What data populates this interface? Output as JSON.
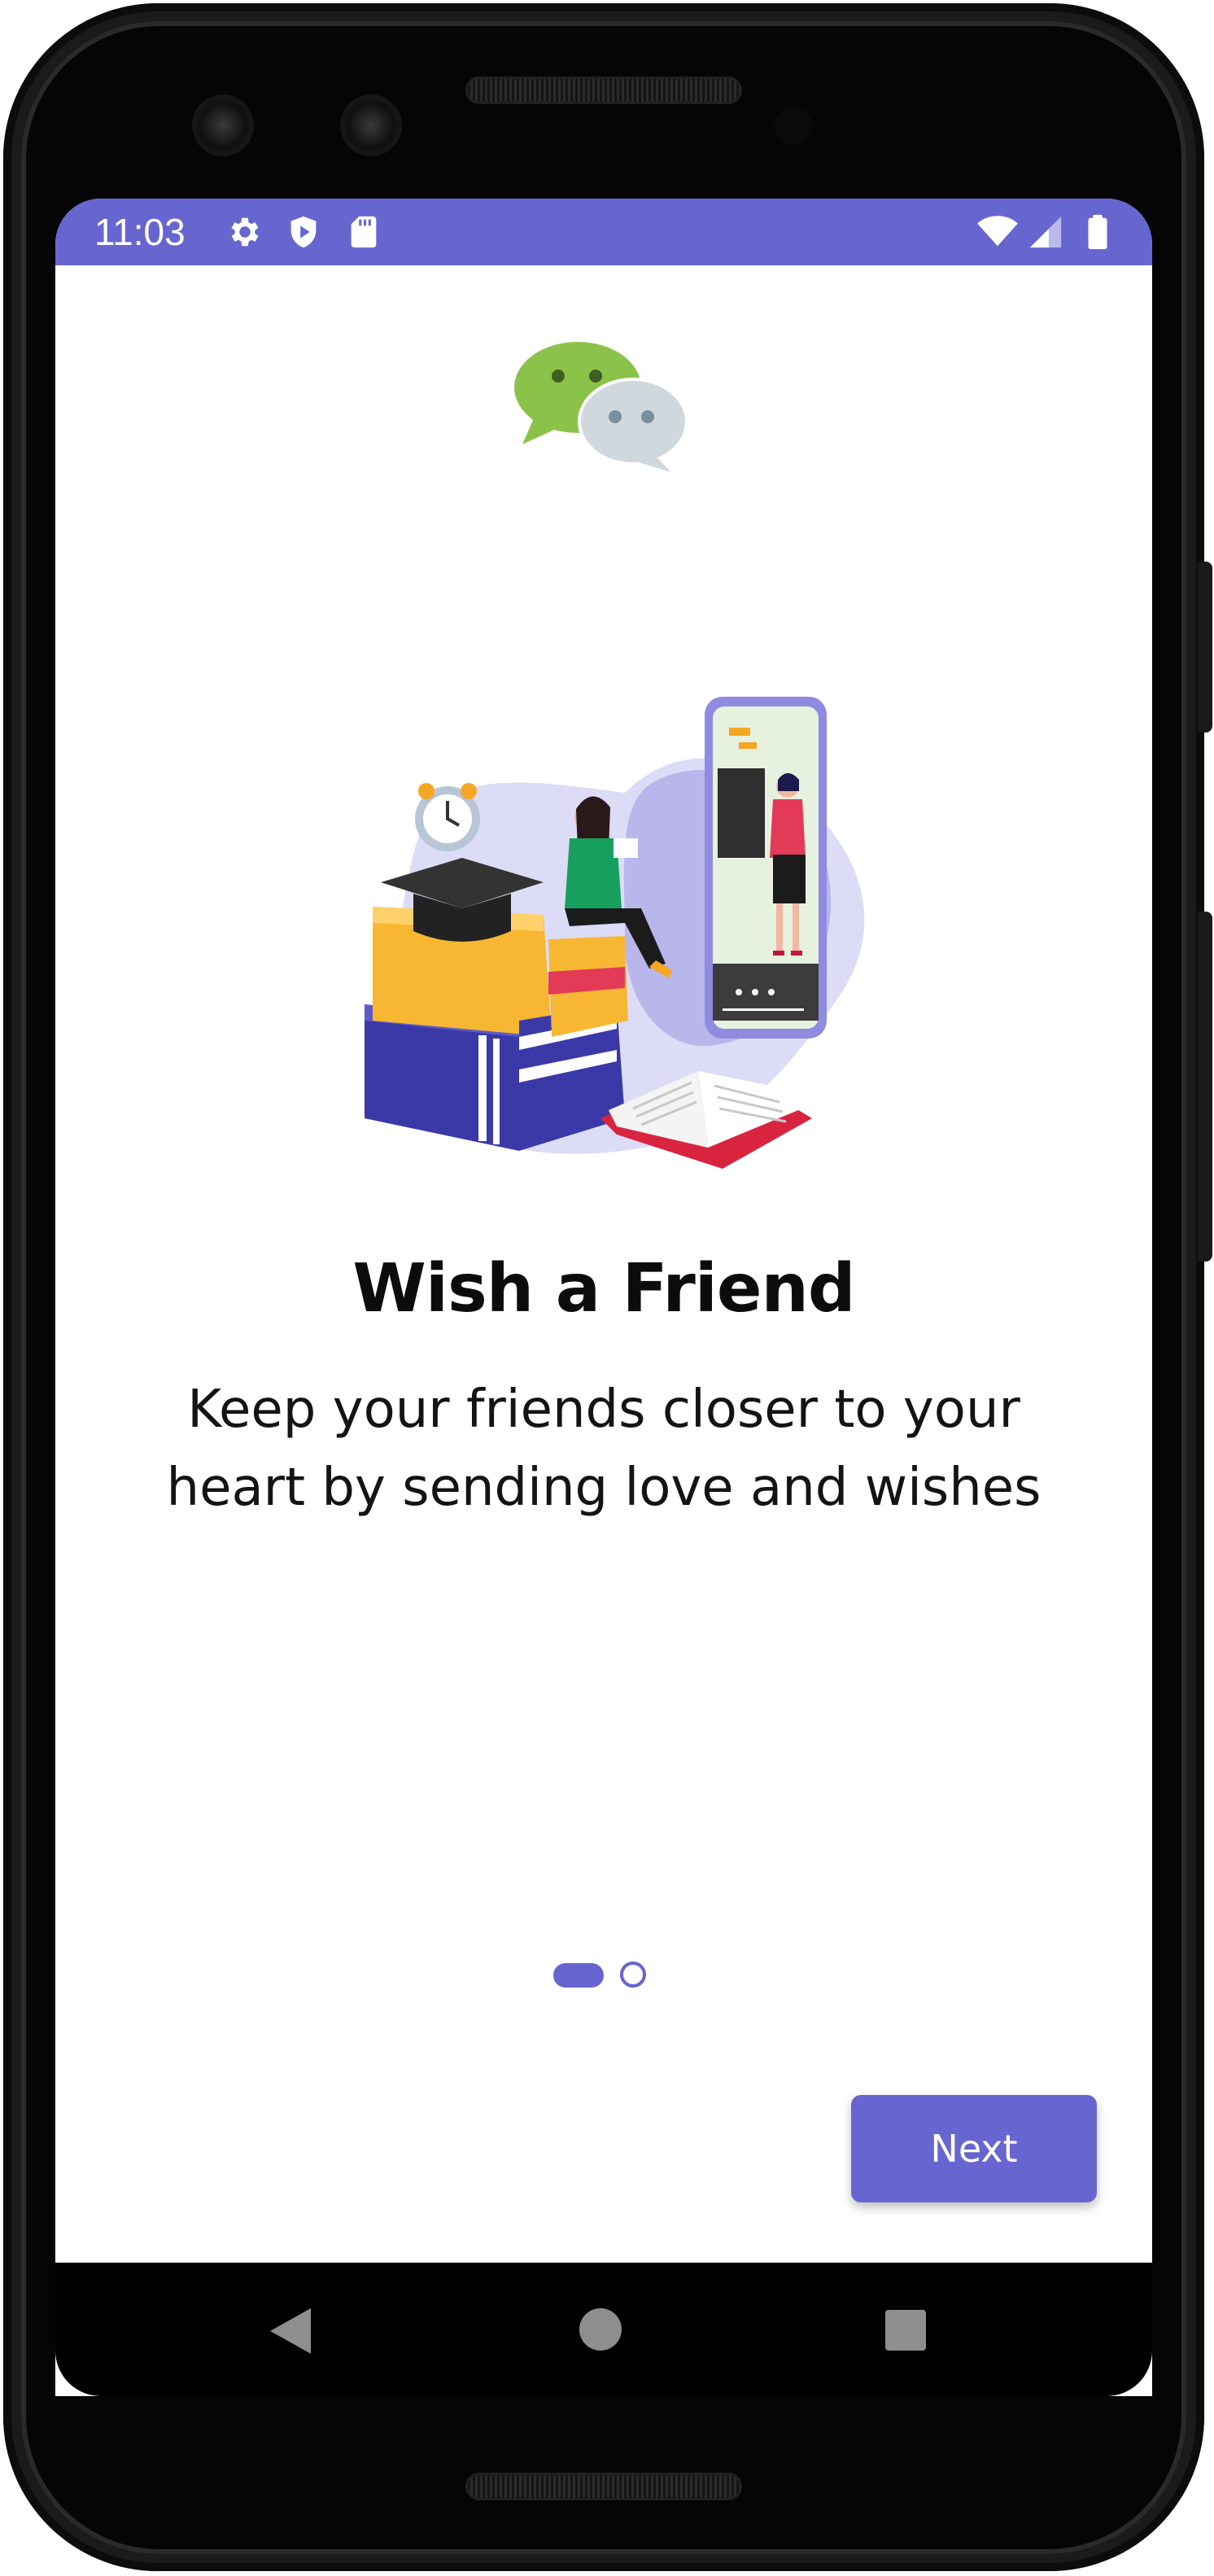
{
  "status_bar": {
    "time": "11:03",
    "left_icons": [
      "gear-icon",
      "shield-play-icon",
      "sd-card-icon"
    ],
    "right_icons": [
      "wifi-icon",
      "signal-icon",
      "battery-icon"
    ],
    "color": "#6766d0"
  },
  "onboarding": {
    "title": "Wish a Friend",
    "subtitle": "Keep your friends closer to your heart by sending love and wishes",
    "page_indicator": {
      "current": 1,
      "total": 2
    },
    "next_label": "Next"
  },
  "nav_bar": {
    "icons": [
      "back-icon",
      "home-icon",
      "recents-icon"
    ]
  },
  "colors": {
    "accent": "#6766d0",
    "logo_green": "#8bc34a",
    "logo_grey": "#cfd8dc"
  }
}
